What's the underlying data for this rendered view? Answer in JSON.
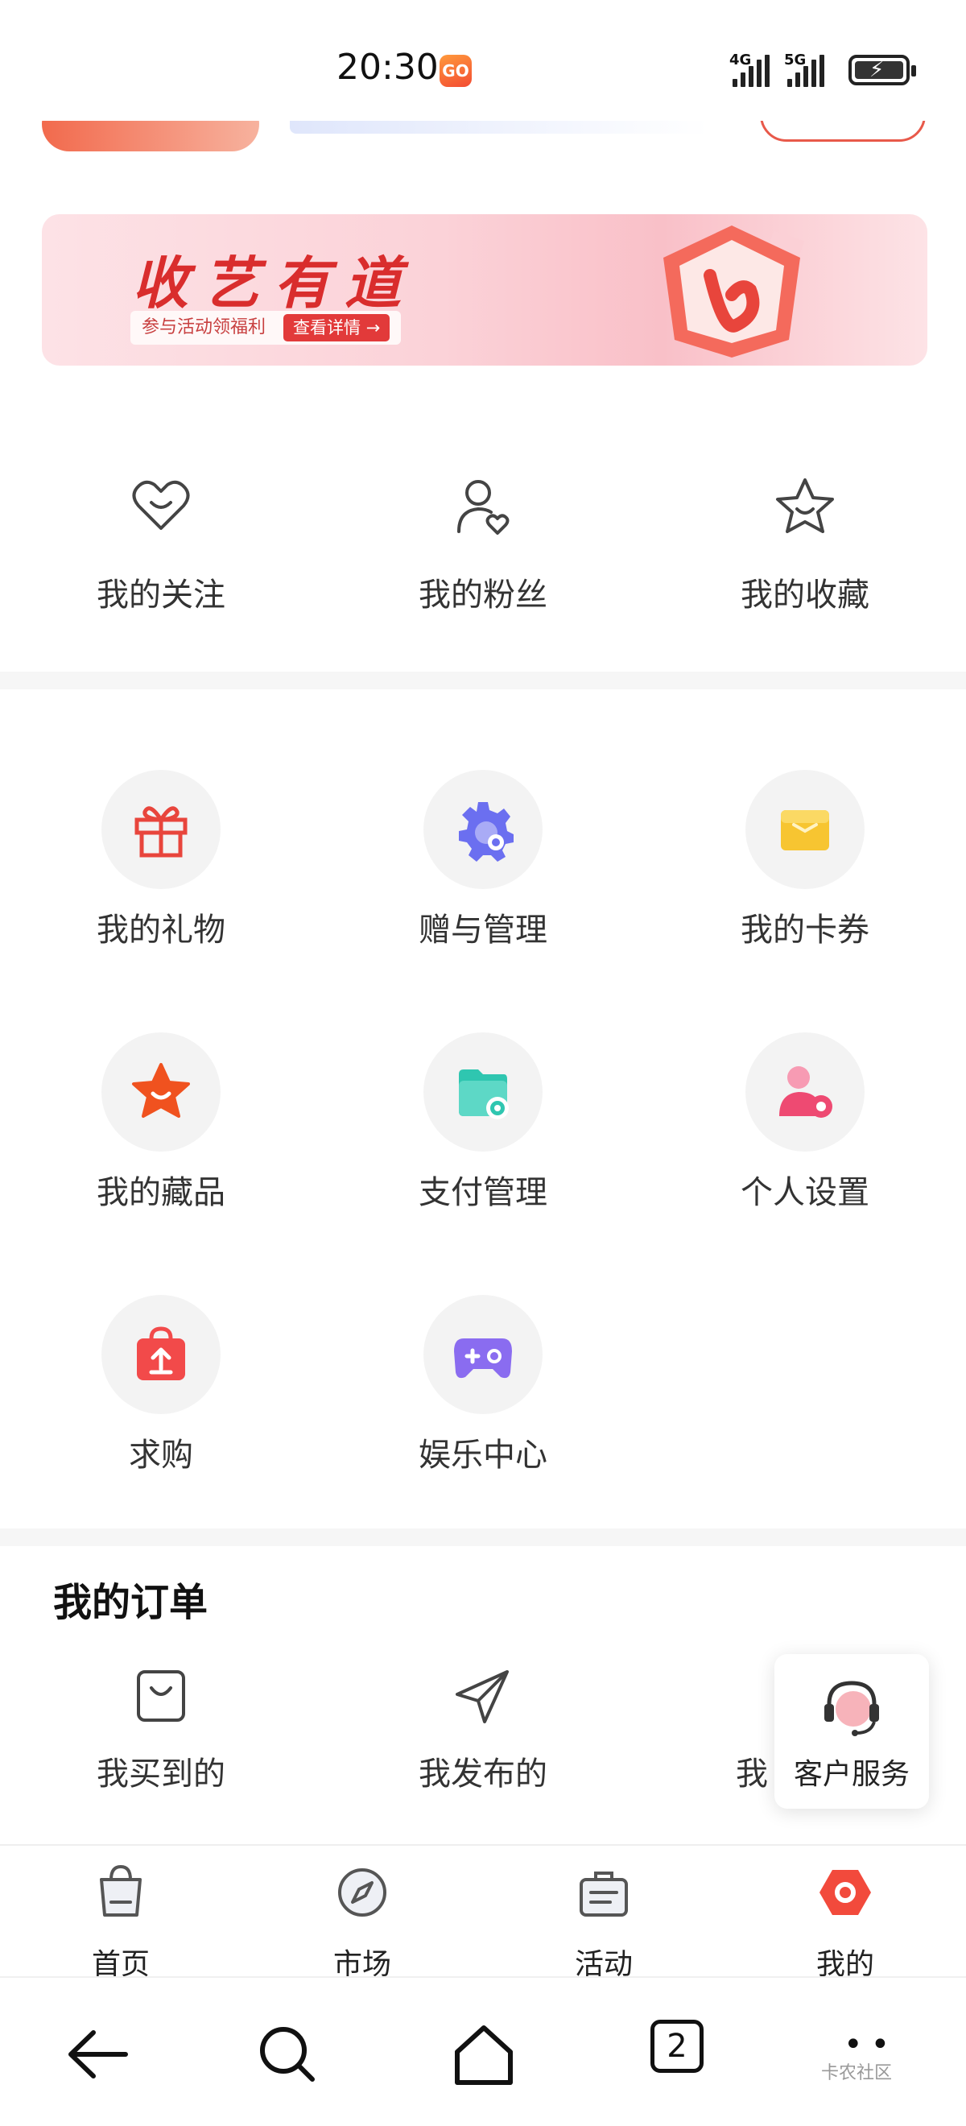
{
  "status_bar": {
    "time": "20:30",
    "app_badge": "GO",
    "signal1_label": "4G",
    "signal2_label": "5G"
  },
  "banner": {
    "title": "收艺有道",
    "subtitle": "参与活动领福利",
    "button": "查看详情 →"
  },
  "social": {
    "items": [
      {
        "label": "我的关注",
        "icon": "heart-smile-icon"
      },
      {
        "label": "我的粉丝",
        "icon": "user-heart-icon"
      },
      {
        "label": "我的收藏",
        "icon": "star-icon"
      }
    ]
  },
  "services": {
    "items": [
      {
        "label": "我的礼物",
        "icon": "gift-icon",
        "color": "#e8453c"
      },
      {
        "label": "赠与管理",
        "icon": "gear-icon",
        "color": "#6b6ff0"
      },
      {
        "label": "我的卡券",
        "icon": "card-icon",
        "color": "#f7c531"
      },
      {
        "label": "我的藏品",
        "icon": "star-face-icon",
        "color": "#f0521f"
      },
      {
        "label": "支付管理",
        "icon": "wallet-gear-icon",
        "color": "#2fc6b0"
      },
      {
        "label": "个人设置",
        "icon": "user-settings-icon",
        "color": "#ee4a72"
      },
      {
        "label": "求购",
        "icon": "bag-upload-icon",
        "color": "#f24a4a"
      },
      {
        "label": "娱乐中心",
        "icon": "gamepad-icon",
        "color": "#8a6cf0"
      }
    ]
  },
  "orders": {
    "title": "我的订单",
    "items": [
      {
        "label": "我买到的",
        "icon": "bag-icon"
      },
      {
        "label": "我发布的",
        "icon": "send-icon"
      },
      {
        "label": "我",
        "icon": "hidden-icon"
      }
    ]
  },
  "customer_service": {
    "label": "客户服务"
  },
  "tabbar": {
    "items": [
      {
        "label": "首页",
        "icon": "shopping-bag-icon"
      },
      {
        "label": "市场",
        "icon": "compass-icon"
      },
      {
        "label": "活动",
        "icon": "clipboard-icon"
      },
      {
        "label": "我的",
        "icon": "hexagon-icon",
        "active": true
      }
    ],
    "active_color": "#f24a3c"
  },
  "system_nav": {
    "tab_count": "2",
    "watermark": "卡农社区"
  }
}
